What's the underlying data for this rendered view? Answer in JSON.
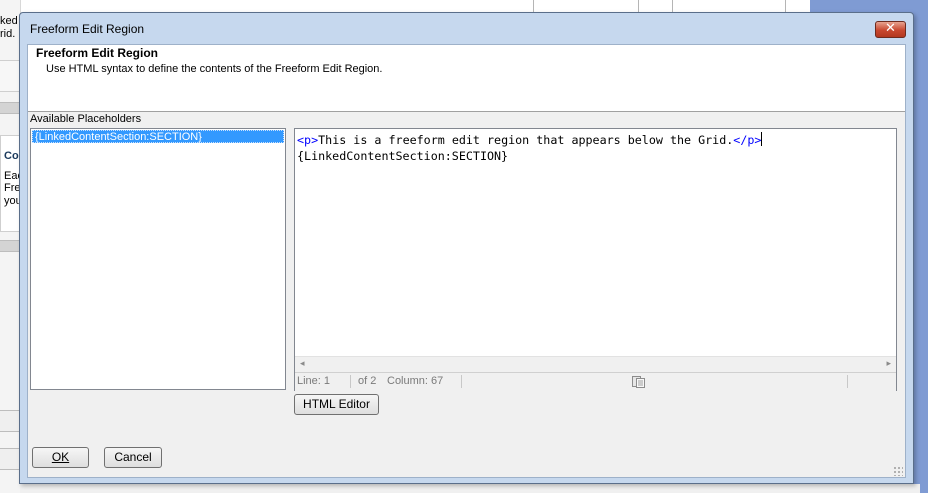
{
  "background_app": {
    "snippets": [
      "ked",
      "rid.",
      "Co",
      "Eac",
      "Fre",
      "you"
    ]
  },
  "dialog": {
    "title": "Freeform Edit Region",
    "close_label": "✕",
    "header_title": "Freeform Edit Region",
    "header_description": "Use HTML syntax to define the contents of the Freeform Edit Region.",
    "placeholders_label": "Available Placeholders",
    "placeholders": [
      "{LinkedContentSection:SECTION}"
    ],
    "editor": {
      "line1_open_tag": "<p>",
      "line1_text": "This is a freeform edit region that appears below the Grid.",
      "line1_close_tag": "</p>",
      "line2": "{LinkedContentSection:SECTION}"
    },
    "status": {
      "line": "Line: 1",
      "of": "of 2",
      "column": "Column: 67"
    },
    "html_editor_button": "HTML Editor",
    "ok_button": "OK",
    "cancel_button": "Cancel"
  },
  "colors": {
    "selection": "#3399ff",
    "tag_color": "#0000ff",
    "title_bar": "#c6d8ee",
    "close_button": "#c8472f"
  },
  "icons": [
    "close-icon",
    "document-icon",
    "scroll-left-icon",
    "scroll-right-icon",
    "resize-grip-icon"
  ]
}
